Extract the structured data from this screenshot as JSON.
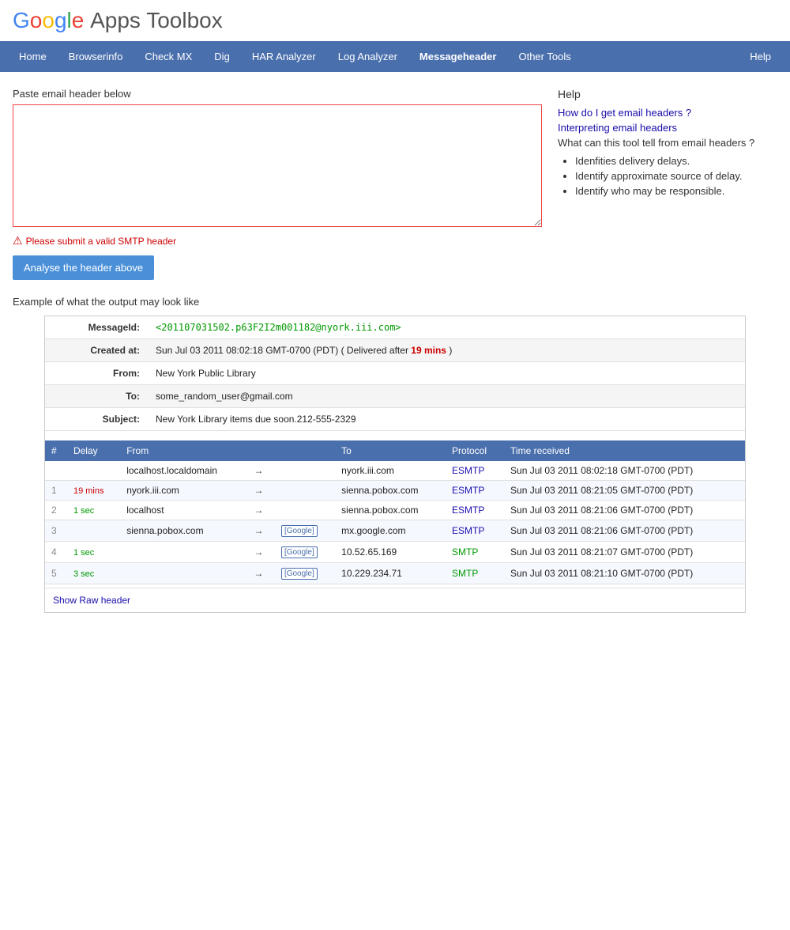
{
  "header": {
    "title_plain": "Apps Toolbox",
    "brand": "Google"
  },
  "nav": {
    "items": [
      {
        "id": "home",
        "label": "Home",
        "active": false
      },
      {
        "id": "browserinfo",
        "label": "Browserinfo",
        "active": false
      },
      {
        "id": "checkmx",
        "label": "Check MX",
        "active": false
      },
      {
        "id": "dig",
        "label": "Dig",
        "active": false
      },
      {
        "id": "har-analyzer",
        "label": "HAR Analyzer",
        "active": false
      },
      {
        "id": "log-analyzer",
        "label": "Log Analyzer",
        "active": false
      },
      {
        "id": "messageheader",
        "label": "Messageheader",
        "active": true
      },
      {
        "id": "other-tools",
        "label": "Other Tools",
        "active": false
      }
    ],
    "help_label": "Help"
  },
  "paste_section": {
    "label": "Paste email header below",
    "textarea_placeholder": "",
    "error_message": "Please submit a valid SMTP header",
    "analyse_button": "Analyse the header above"
  },
  "help_section": {
    "title": "Help",
    "links": [
      {
        "id": "link-get-headers",
        "text": "How do I get email headers ?"
      },
      {
        "id": "link-interpreting",
        "text": "Interpreting email headers"
      }
    ],
    "desc": "What can this tool tell from email headers ?",
    "list_items": [
      "Idenfities delivery delays.",
      "Identify approximate source of delay.",
      "Identify who may be responsible."
    ]
  },
  "example": {
    "label": "Example of what the output may look like",
    "message_info": {
      "fields": [
        {
          "label": "MessageId:",
          "value": "<201107031502.p63F2I2m001182@nyork.iii.com>",
          "type": "msg-id"
        },
        {
          "label": "Created at:",
          "value": "Sun Jul 03 2011 08:02:18 GMT-0700 (PDT) ( Delivered after ",
          "highlight": "19 mins",
          "suffix": " )",
          "type": "highlight"
        },
        {
          "label": "From:",
          "value": "New York Public Library",
          "type": "normal"
        },
        {
          "label": "To:",
          "value": "some_random_user@gmail.com",
          "type": "normal"
        },
        {
          "label": "Subject:",
          "value": "New York Library items due soon.212-555-2329",
          "type": "normal"
        }
      ]
    },
    "table": {
      "headers": [
        "#",
        "Delay",
        "From",
        "",
        "",
        "To",
        "Protocol",
        "Time received"
      ],
      "rows": [
        {
          "num": "",
          "delay": "",
          "from": "localhost.localdomain",
          "arrow": "→",
          "google": false,
          "to": "nyork.iii.com",
          "protocol": "ESMTP",
          "time": "Sun Jul 03 2011 08:02:18 GMT-0700 (PDT)",
          "delay_class": ""
        },
        {
          "num": "1",
          "delay": "19 mins",
          "from": "nyork.iii.com",
          "arrow": "→",
          "google": false,
          "to": "sienna.pobox.com",
          "protocol": "ESMTP",
          "time": "Sun Jul 03 2011 08:21:05 GMT-0700 (PDT)",
          "delay_class": "red"
        },
        {
          "num": "2",
          "delay": "1 sec",
          "from": "localhost",
          "arrow": "→",
          "google": false,
          "to": "sienna.pobox.com",
          "protocol": "ESMTP",
          "time": "Sun Jul 03 2011 08:21:06 GMT-0700 (PDT)",
          "delay_class": "green"
        },
        {
          "num": "3",
          "delay": "",
          "from": "sienna.pobox.com",
          "arrow": "→",
          "google": true,
          "to": "mx.google.com",
          "protocol": "ESMTP",
          "time": "Sun Jul 03 2011 08:21:06 GMT-0700 (PDT)",
          "delay_class": ""
        },
        {
          "num": "4",
          "delay": "1 sec",
          "from": "",
          "arrow": "→",
          "google": true,
          "to": "10.52.65.169",
          "protocol": "SMTP",
          "time": "Sun Jul 03 2011 08:21:07 GMT-0700 (PDT)",
          "delay_class": "green"
        },
        {
          "num": "5",
          "delay": "3 sec",
          "from": "",
          "arrow": "→",
          "google": true,
          "to": "10.229.234.71",
          "protocol": "SMTP",
          "time": "Sun Jul 03 2011 08:21:10 GMT-0700 (PDT)",
          "delay_class": "green"
        }
      ]
    },
    "show_raw": "Show Raw header"
  }
}
